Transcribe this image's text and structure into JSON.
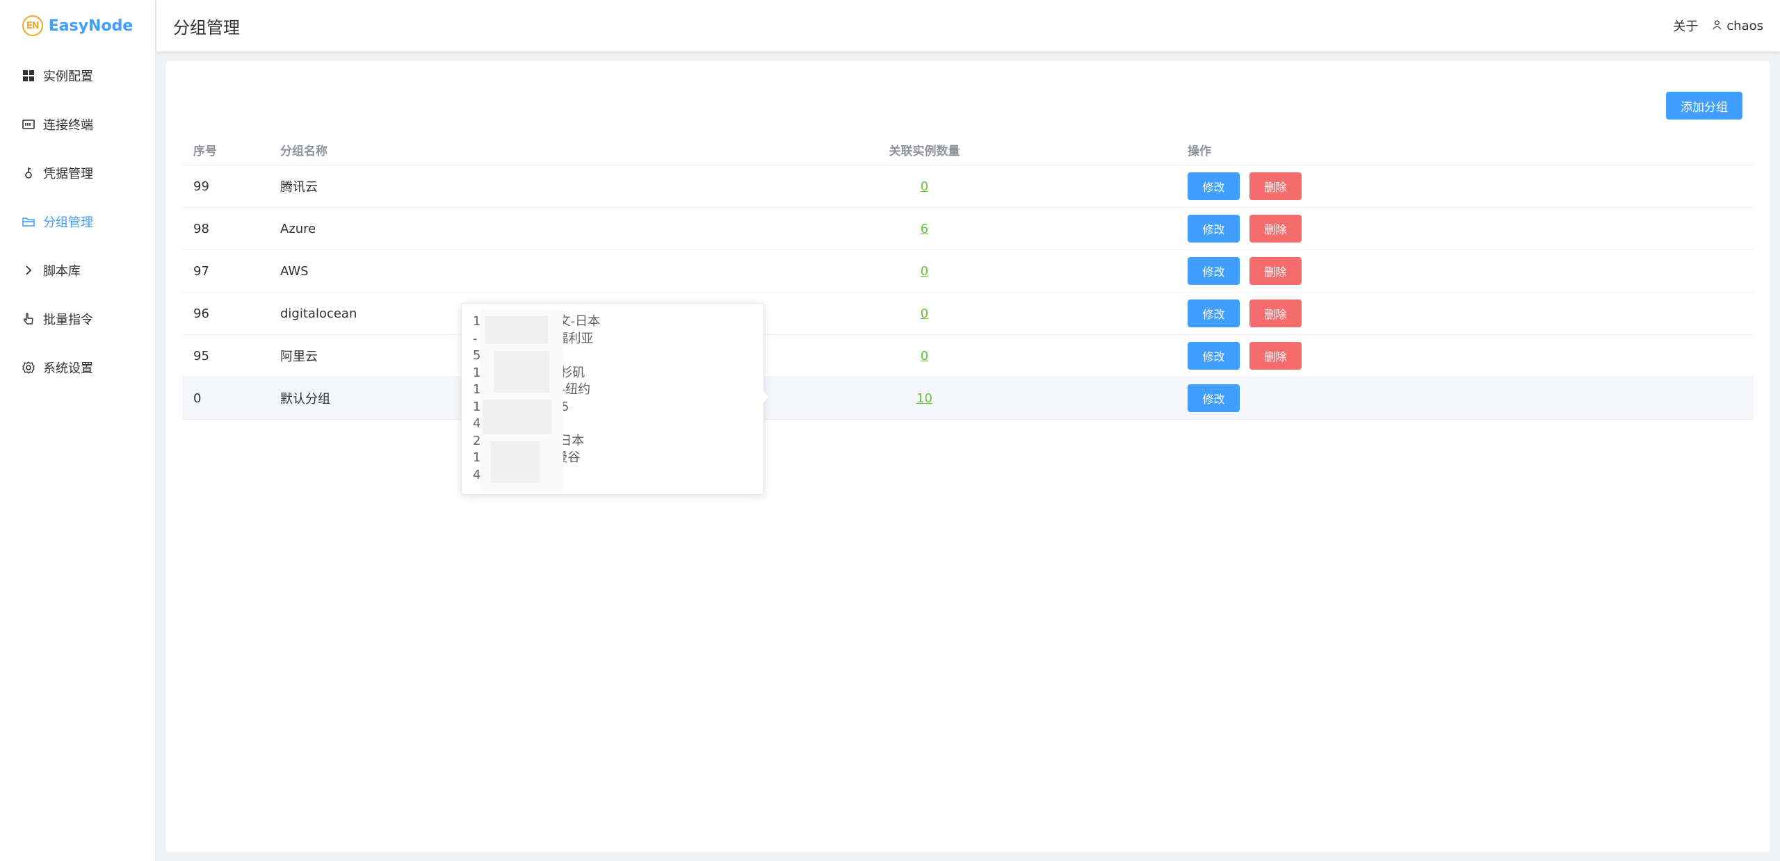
{
  "app": {
    "logo_badge": "EN",
    "name": "EasyNode"
  },
  "sidebar": {
    "items": [
      {
        "label": "实例配置",
        "icon": "grid-icon",
        "active": false
      },
      {
        "label": "连接终端",
        "icon": "terminal-icon",
        "active": false
      },
      {
        "label": "凭据管理",
        "icon": "key-icon",
        "active": false
      },
      {
        "label": "分组管理",
        "icon": "folder-icon",
        "active": true
      },
      {
        "label": "脚本库",
        "icon": "chevron-right-icon",
        "active": false
      },
      {
        "label": "批量指令",
        "icon": "pointer-icon",
        "active": false
      },
      {
        "label": "系统设置",
        "icon": "gear-icon",
        "active": false
      }
    ]
  },
  "header": {
    "title": "分组管理",
    "about": "关于",
    "username": "chaos"
  },
  "main": {
    "add_button": "添加分组",
    "columns": {
      "index": "序号",
      "name": "分组名称",
      "count": "关联实例数量",
      "actions": "操作"
    },
    "rows": [
      {
        "index": "99",
        "name": "腾讯云",
        "count": "0",
        "edit": "修改",
        "delete": "删除"
      },
      {
        "index": "98",
        "name": "Azure",
        "count": "6",
        "edit": "修改",
        "delete": "删除"
      },
      {
        "index": "97",
        "name": "AWS",
        "count": "0",
        "edit": "修改",
        "delete": "删除"
      },
      {
        "index": "96",
        "name": "digitalocean",
        "count": "0",
        "edit": "修改",
        "delete": "删除"
      },
      {
        "index": "95",
        "name": "阿里云",
        "count": "0",
        "edit": "修改",
        "delete": "删除"
      },
      {
        "index": "0",
        "name": "默认分组",
        "count": "10",
        "edit": "修改",
        "delete": null
      }
    ]
  },
  "tooltip": {
    "lines": [
      "15        3 - 03 甲骨文-日本",
      "         - 05 哇沃-加利福利亚",
      "5         06 AWS-悉尼",
      "148      - 07 cc-洛杉矶",
      "165      7 - 14 DO-纽约",
      "114.      4 - TX-125",
      "4        - 阿里T6",
      "        2 - 02 搬瓦工- 日本",
      "12       6 - 华为云-曼谷",
      "4        - 01 TX-HK"
    ]
  },
  "colors": {
    "primary": "#409eff",
    "danger": "#f56c6c",
    "success": "#67c23a"
  }
}
